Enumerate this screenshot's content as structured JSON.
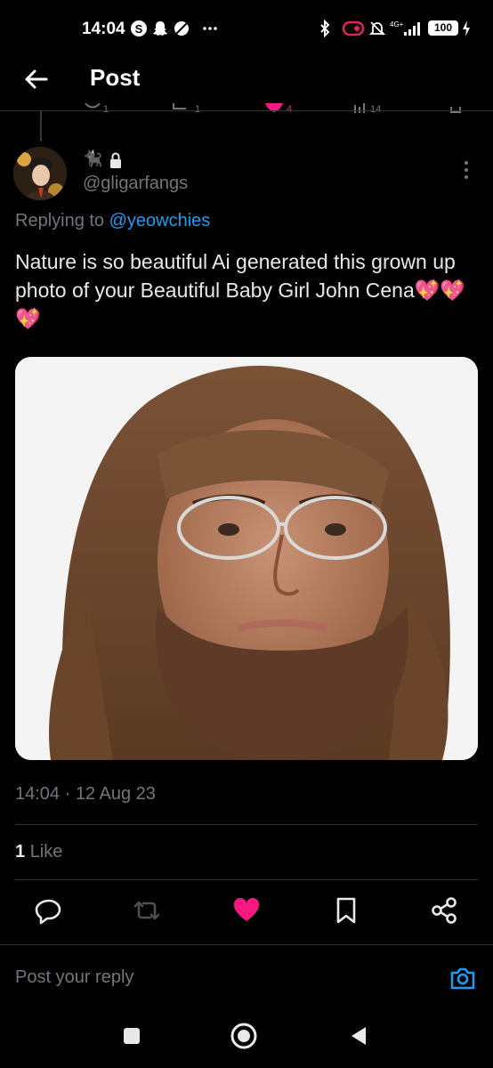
{
  "status_bar": {
    "time": "14:04",
    "battery": "100"
  },
  "header": {
    "title": "Post"
  },
  "post": {
    "handle": "@gligarfangs",
    "replying_prefix": "Replying to",
    "replying_to": "@yeowchies",
    "text": "Nature is so beautiful Ai generated this grown up photo of your Beautiful Baby Girl John Cena",
    "emojis": "💖💖💖",
    "timestamp": "14:04 · 12 Aug 23",
    "like_count": "1",
    "like_label": "Like"
  },
  "reply": {
    "placeholder": "Post your reply"
  },
  "icons": [
    "back-arrow-icon",
    "more-options-icon",
    "reply-icon",
    "repost-icon",
    "like-icon",
    "bookmark-icon",
    "share-icon",
    "camera-icon",
    "lock-icon"
  ],
  "colors": {
    "accent": "#1d9bf0",
    "like": "#f91880",
    "muted": "#71767b",
    "text": "#e7e9ea"
  }
}
